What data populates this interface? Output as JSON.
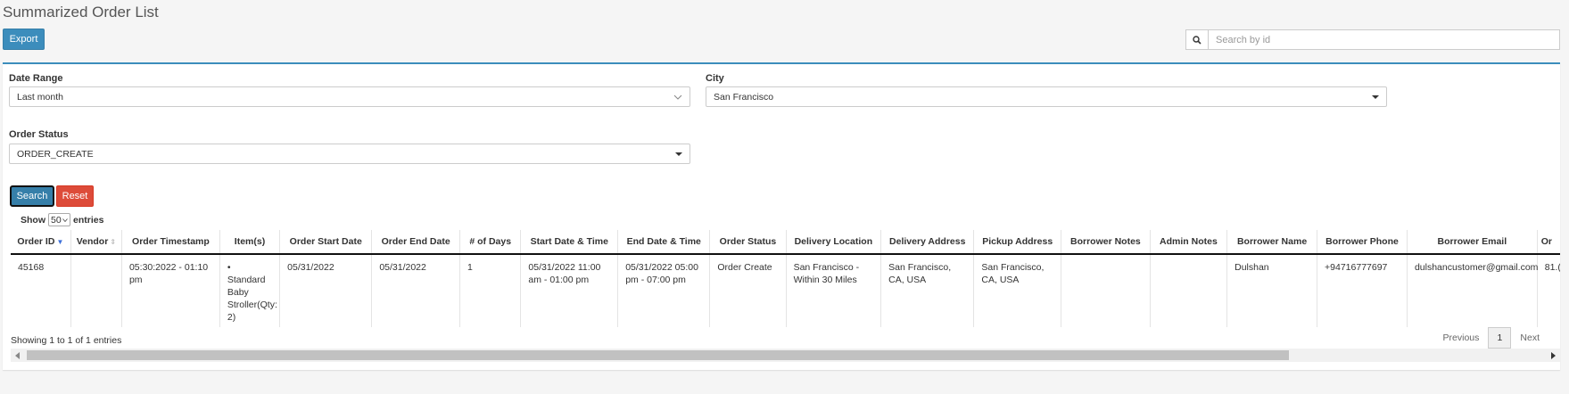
{
  "page": {
    "title": "Summarized Order List"
  },
  "toolbar": {
    "export_label": "Export"
  },
  "search": {
    "placeholder": "Search by id",
    "value": "",
    "icon": "search-icon"
  },
  "filters": {
    "date_range": {
      "label": "Date Range",
      "value": "Last month"
    },
    "city": {
      "label": "City",
      "value": "San Francisco"
    },
    "order_status": {
      "label": "Order Status",
      "value": "ORDER_CREATE"
    },
    "search_label": "Search",
    "reset_label": "Reset"
  },
  "table_length": {
    "show_label": "Show",
    "value": "50",
    "entries_label": "entries"
  },
  "table": {
    "columns": [
      "Order ID",
      "Vendor",
      "Order Timestamp",
      "Item(s)",
      "Order Start Date",
      "Order End Date",
      "# of Days",
      "Start Date & Time",
      "End Date & Time",
      "Order Status",
      "Delivery Location",
      "Delivery Address",
      "Pickup Address",
      "Borrower Notes",
      "Admin Notes",
      "Borrower Name",
      "Borrower Phone",
      "Borrower Email",
      "Or"
    ],
    "rows": [
      {
        "order_id": "45168",
        "vendor": "",
        "order_timestamp": "05:30:2022 - 01:10 pm",
        "items": "Standard Baby Stroller(Qty: 2)",
        "order_start_date": "05/31/2022",
        "order_end_date": "05/31/2022",
        "days": "1",
        "start_datetime": "05/31/2022 11:00 am - 01:00 pm",
        "end_datetime": "05/31/2022 05:00 pm - 07:00 pm",
        "order_status": "Order Create",
        "delivery_location": "San Francisco - Within 30 Miles",
        "delivery_address": "San Francisco, CA, USA",
        "pickup_address": "San Francisco, CA, USA",
        "borrower_notes": "",
        "admin_notes": "",
        "borrower_name": "Dulshan",
        "borrower_phone": "+94716777697",
        "borrower_email": "dulshancustomer@gmail.com",
        "or": "81.("
      }
    ]
  },
  "footer": {
    "info": "Showing 1 to 1 of 1 entries",
    "previous_label": "Previous",
    "current_page": "1",
    "next_label": "Next"
  },
  "colors": {
    "primary": "#3c8dbc",
    "danger": "#dd4b39",
    "search_active": "#367fa9"
  }
}
